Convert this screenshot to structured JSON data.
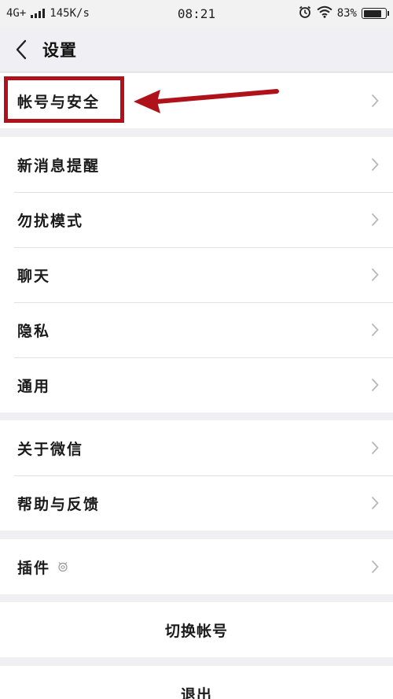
{
  "status_bar": {
    "network": "4G+",
    "speed": "145K/s",
    "time": "08:21",
    "battery_percent": "83%",
    "battery_level": 0.83
  },
  "header": {
    "title": "设置",
    "back_icon": "chevron-left-icon"
  },
  "settings": {
    "account_security": "帐号与安全",
    "new_message_alerts": "新消息提醒",
    "do_not_disturb": "勿扰模式",
    "chat": "聊天",
    "privacy": "隐私",
    "general": "通用",
    "about_wechat": "关于微信",
    "help_feedback": "帮助与反馈",
    "plugins": "插件",
    "switch_account": "切换帐号",
    "logout": "退出"
  },
  "annotation": {
    "highlight_color": "#b0121b"
  },
  "colors": {
    "background": "#efeff4",
    "row_background": "#ffffff",
    "chevron": "#b8b8b8"
  }
}
